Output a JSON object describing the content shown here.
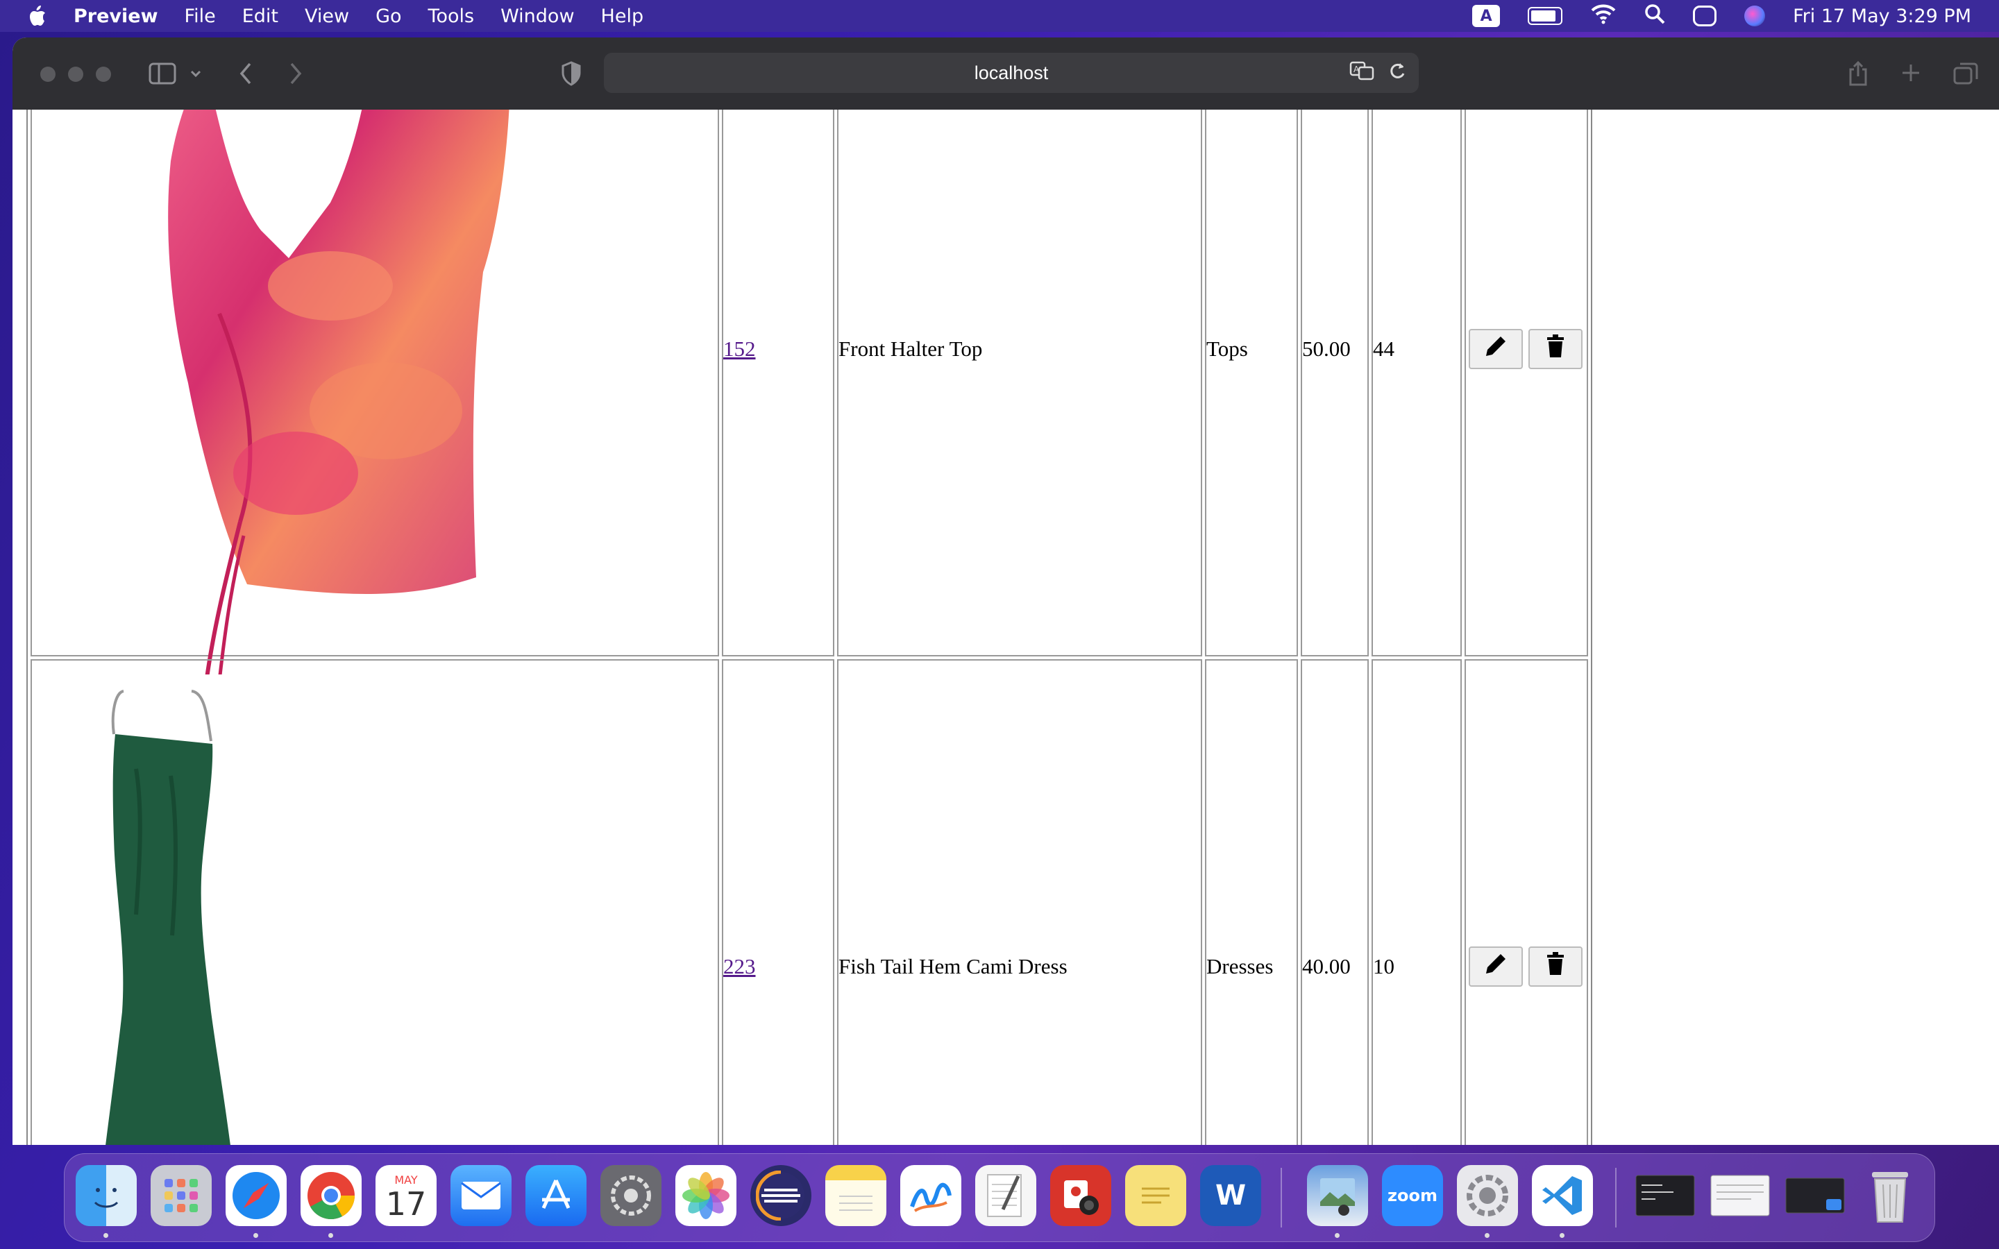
{
  "menubar": {
    "app_name": "Preview",
    "items": [
      "File",
      "Edit",
      "View",
      "Go",
      "Tools",
      "Window",
      "Help"
    ],
    "input_indicator": "A",
    "datetime": "Fri 17 May  3:29 PM"
  },
  "browser": {
    "url": "localhost"
  },
  "table": {
    "rows": [
      {
        "id": "152",
        "name": "Front Halter Top",
        "category": "Tops",
        "price": "50.00",
        "quantity": "44"
      },
      {
        "id": "223",
        "name": "Fish Tail Hem Cami Dress",
        "category": "Dresses",
        "price": "40.00",
        "quantity": "10"
      }
    ]
  },
  "dock": {
    "calendar_month": "MAY",
    "calendar_day": "17",
    "zoom_label": "zoom",
    "word_label": "W"
  }
}
